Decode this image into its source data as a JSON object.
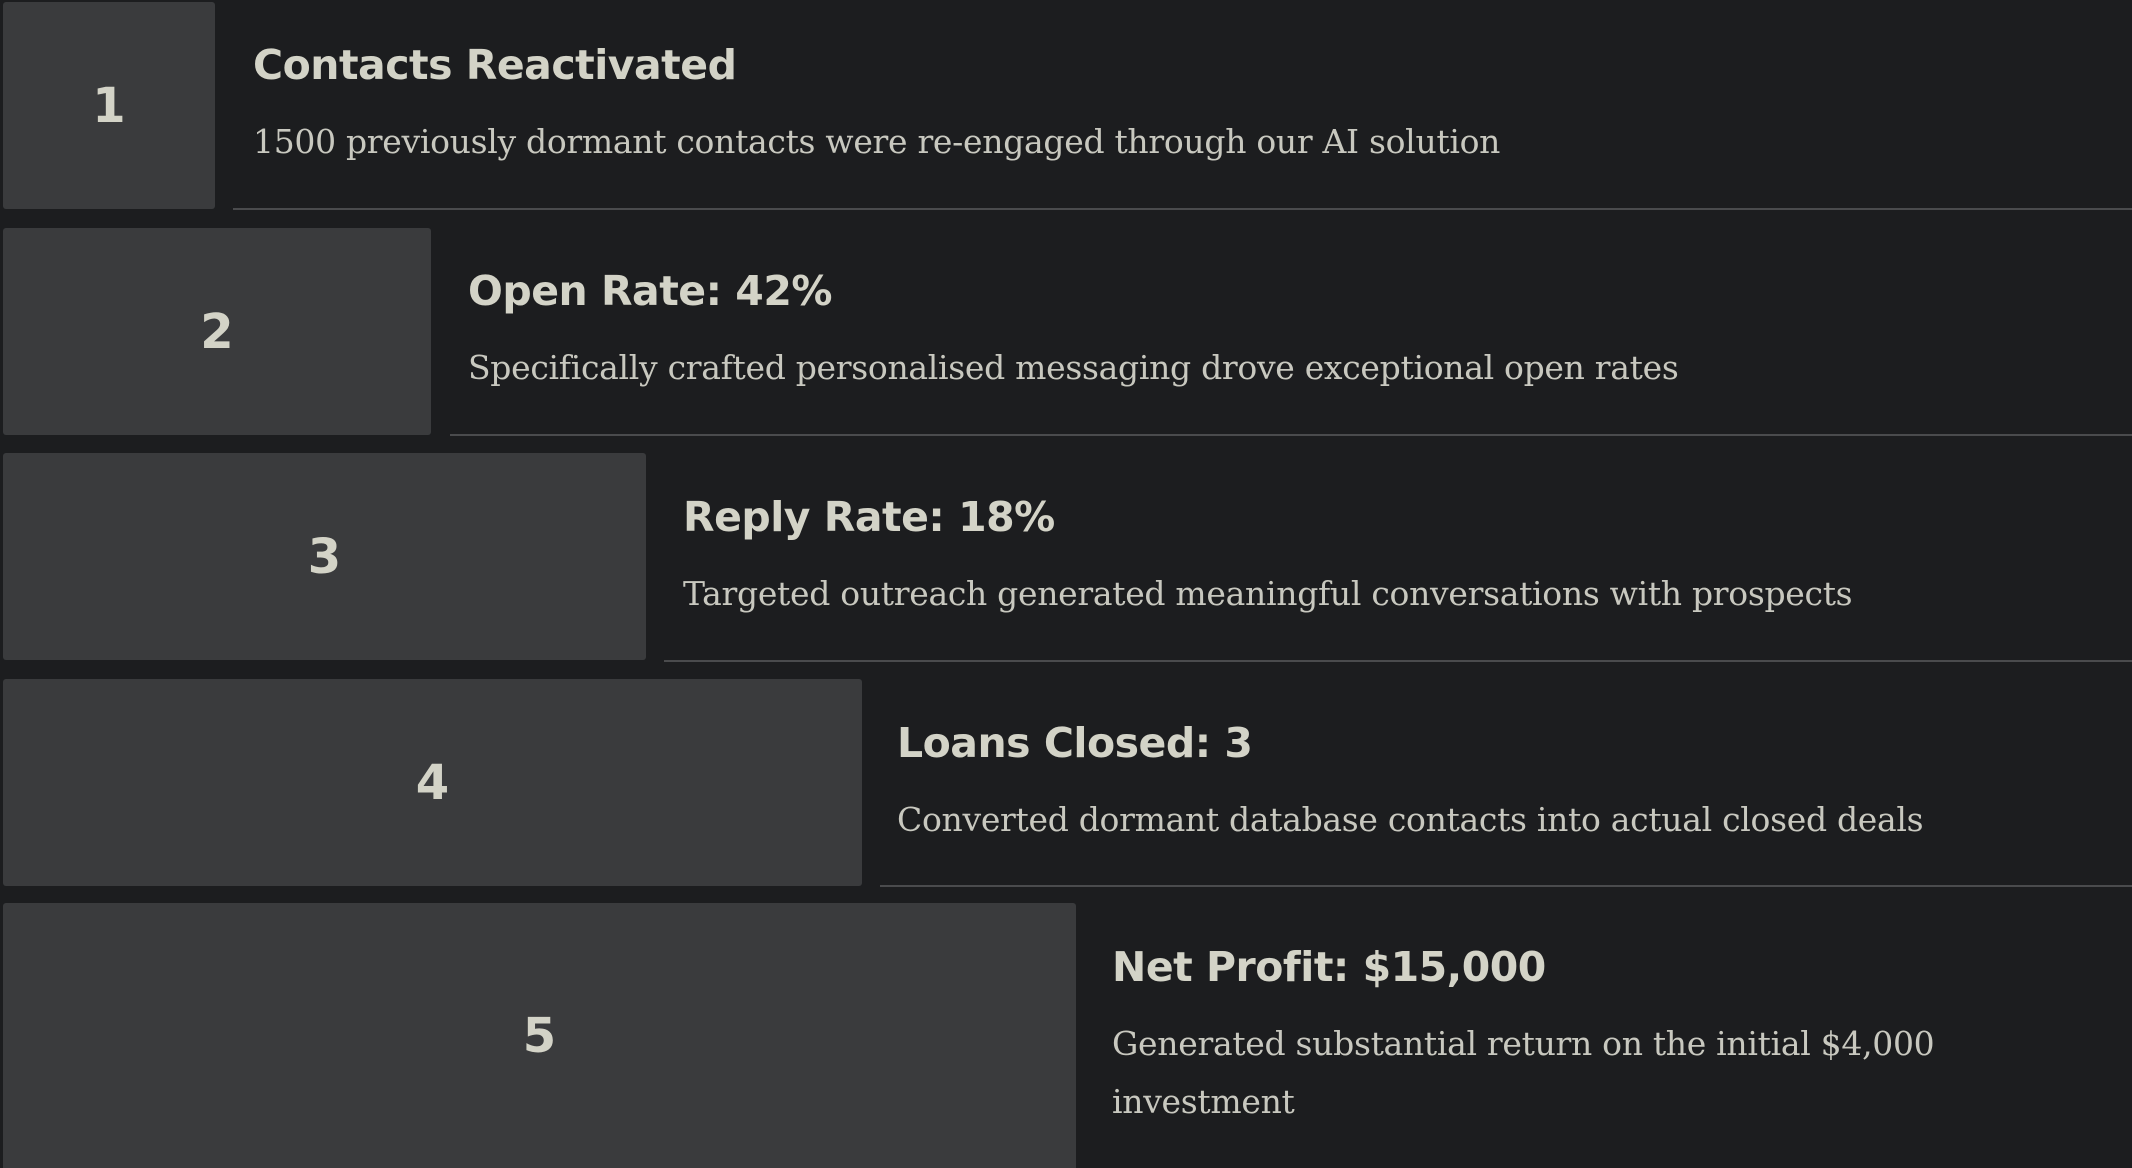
{
  "steps": [
    {
      "number": "1",
      "title": "Contacts Reactivated",
      "description": "1500 previously dormant contacts were re-engaged through our AI solution"
    },
    {
      "number": "2",
      "title": "Open Rate: 42%",
      "description": "Specifically crafted personalised messaging drove exceptional open rates"
    },
    {
      "number": "3",
      "title": "Reply Rate: 18%",
      "description": "Targeted outreach generated meaningful conversations with prospects"
    },
    {
      "number": "4",
      "title": "Loans Closed: 3",
      "description": "Converted dormant database contacts into actual closed deals"
    },
    {
      "number": "5",
      "title": "Net Profit: $15,000",
      "description": "Generated substantial return on the initial $4,000 investment"
    }
  ],
  "colors": {
    "background": "#1c1d1f",
    "box": "#3a3b3d",
    "text": "#d3d3c7",
    "divider": "#4a4b4d"
  }
}
